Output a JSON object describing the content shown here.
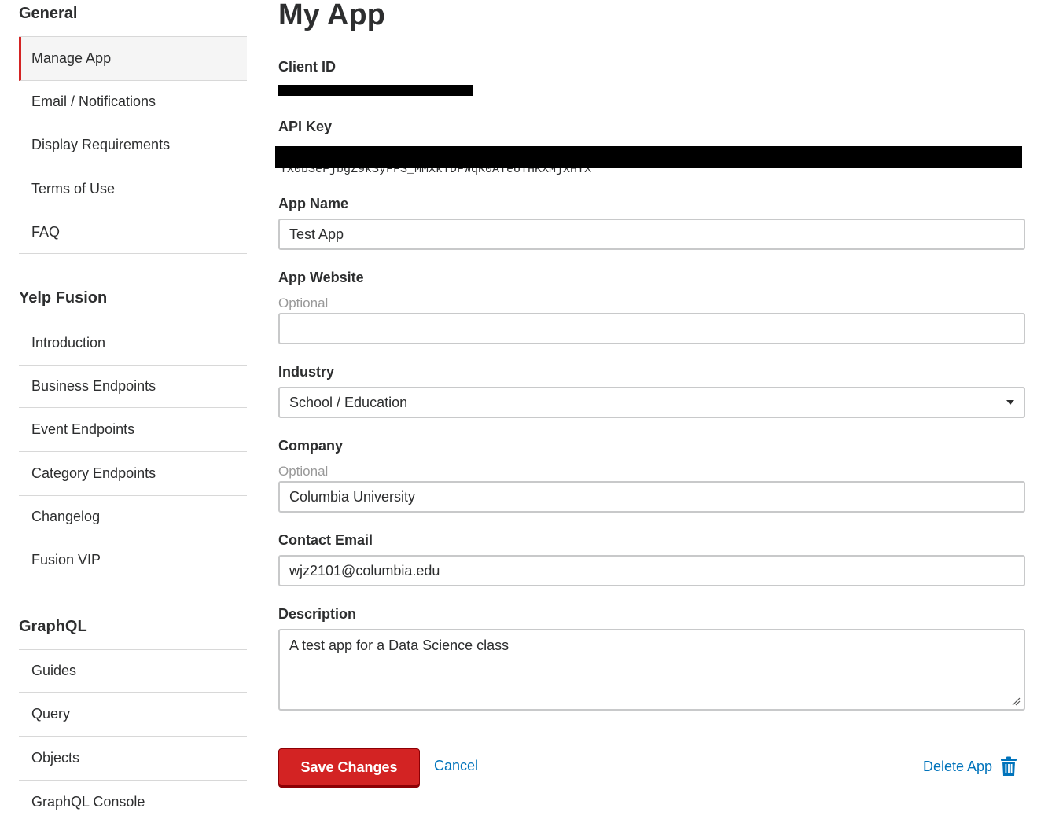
{
  "sidebar": {
    "general": {
      "title": "General",
      "items": [
        "Manage App",
        "Email / Notifications",
        "Display Requirements",
        "Terms of Use",
        "FAQ"
      ]
    },
    "fusion": {
      "title": "Yelp Fusion",
      "items": [
        "Introduction",
        "Business Endpoints",
        "Event Endpoints",
        "Category Endpoints",
        "Changelog",
        "Fusion VIP"
      ]
    },
    "graphql": {
      "title": "GraphQL",
      "items": [
        "Guides",
        "Query",
        "Objects",
        "GraphQL Console"
      ]
    }
  },
  "main": {
    "title": "My App",
    "client_id": {
      "label": "Client ID"
    },
    "api_key": {
      "label": "API Key",
      "visible_tail": "YX0bSeFjbgZ9kSyFFS_MMXkTDFWqK0ATeUTHKXMjXHYX"
    },
    "app_name": {
      "label": "App Name",
      "value": "Test App"
    },
    "app_website": {
      "label": "App Website",
      "hint": "Optional",
      "value": ""
    },
    "industry": {
      "label": "Industry",
      "value": "School / Education"
    },
    "company": {
      "label": "Company",
      "hint": "Optional",
      "value": "Columbia University"
    },
    "contact_email": {
      "label": "Contact Email",
      "value": "wjz2101@columbia.edu"
    },
    "description": {
      "label": "Description",
      "value": "A test app for a Data Science class"
    },
    "save_label": "Save Changes",
    "cancel_label": "Cancel",
    "delete_label": "Delete App"
  },
  "colors": {
    "brand_red": "#d32323",
    "link_blue": "#0073bb"
  },
  "icons": [
    "trash-icon",
    "chevron-down-icon"
  ]
}
